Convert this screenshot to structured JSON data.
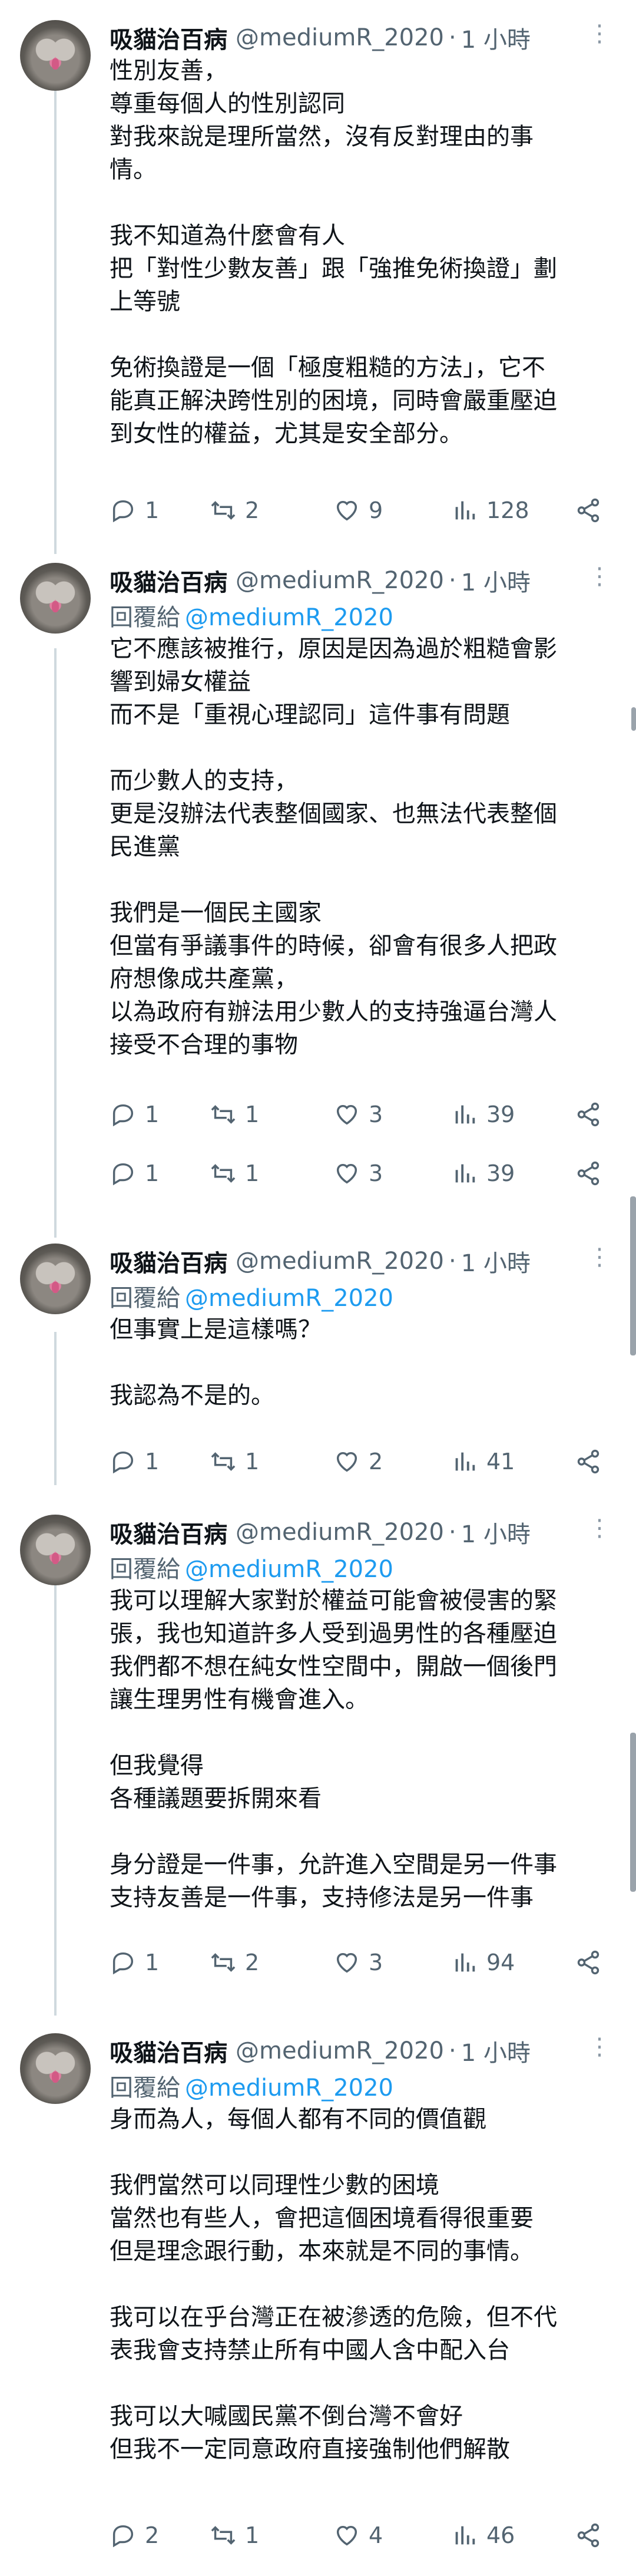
{
  "tweets": [
    {
      "name": "吸貓治百病",
      "handle": "@mediumR_2020",
      "time": "1 小時",
      "reply_to": "",
      "lines": [
        "性別友善，",
        "尊重每個人的性別認同",
        "對我來說是理所當然，沒有反對理由的事",
        "情。",
        "",
        "我不知道為什麼會有人",
        "把「對性少數友善」跟「強推免術換證」劃",
        "上等號",
        "",
        "免術換證是一個「極度粗糙的方法」，它不",
        "能真正解決跨性別的困境，同時會嚴重壓迫",
        "到女性的權益，尤其是安全部分。"
      ],
      "replies": "1",
      "retweets": "2",
      "likes": "9",
      "views": "128"
    },
    {
      "name": "吸貓治百病",
      "handle": "@mediumR_2020",
      "time": "1 小時",
      "reply_to_label": "回覆給",
      "reply_to": "@mediumR_2020",
      "lines": [
        "它不應該被推行，原因是因為過於粗糙會影",
        "響到婦女權益",
        "而不是「重視心理認同」這件事有問題",
        "",
        "而少數人的支持，",
        "更是沒辦法代表整個國家、也無法代表整個",
        "民進黨",
        "",
        "我們是一個民主國家",
        "但當有爭議事件的時候，卻會有很多人把政",
        "府想像成共產黨，",
        "以為政府有辦法用少數人的支持強逼台灣人",
        "接受不合理的事物"
      ],
      "replies": "1",
      "retweets": "1",
      "likes": "3",
      "views": "39",
      "replies2": "1",
      "retweets2": "1",
      "likes2": "3",
      "views2": "39"
    },
    {
      "name": "吸貓治百病",
      "handle": "@mediumR_2020",
      "time": "1 小時",
      "reply_to_label": "回覆給",
      "reply_to": "@mediumR_2020",
      "lines": [
        "但事實上是這樣嗎？",
        "",
        "我認為不是的。"
      ],
      "replies": "1",
      "retweets": "1",
      "likes": "2",
      "views": "41"
    },
    {
      "name": "吸貓治百病",
      "handle": "@mediumR_2020",
      "time": "1 小時",
      "reply_to_label": "回覆給",
      "reply_to": "@mediumR_2020",
      "lines": [
        "我可以理解大家對於權益可能會被侵害的緊",
        "張，我也知道許多人受到過男性的各種壓迫",
        "我們都不想在純女性空間中，開啟一個後門",
        "讓生理男性有機會進入。",
        "",
        "但我覺得",
        "各種議題要拆開來看",
        "",
        "身分證是一件事，允許進入空間是另一件事",
        "支持友善是一件事，支持修法是另一件事"
      ],
      "replies": "1",
      "retweets": "2",
      "likes": "3",
      "views": "94"
    },
    {
      "name": "吸貓治百病",
      "handle": "@mediumR_2020",
      "time": "1 小時",
      "reply_to_label": "回覆給",
      "reply_to": "@mediumR_2020",
      "lines": [
        "身而為人，每個人都有不同的價值觀",
        "",
        "我們當然可以同理性少數的困境",
        "當然也有些人，會把這個困境看得很重要",
        "但是理念跟行動，本來就是不同的事情。",
        "",
        "我可以在乎台灣正在被滲透的危險，但不代",
        "表我會支持禁止所有中國人含中配入台",
        "",
        "我可以大喊國民黨不倒台灣不會好",
        "但我不一定同意政府直接強制他們解散"
      ],
      "replies": "2",
      "retweets": "1",
      "likes": "4",
      "views": "46"
    }
  ],
  "dot_separator": "·",
  "more_glyph": "⋮"
}
